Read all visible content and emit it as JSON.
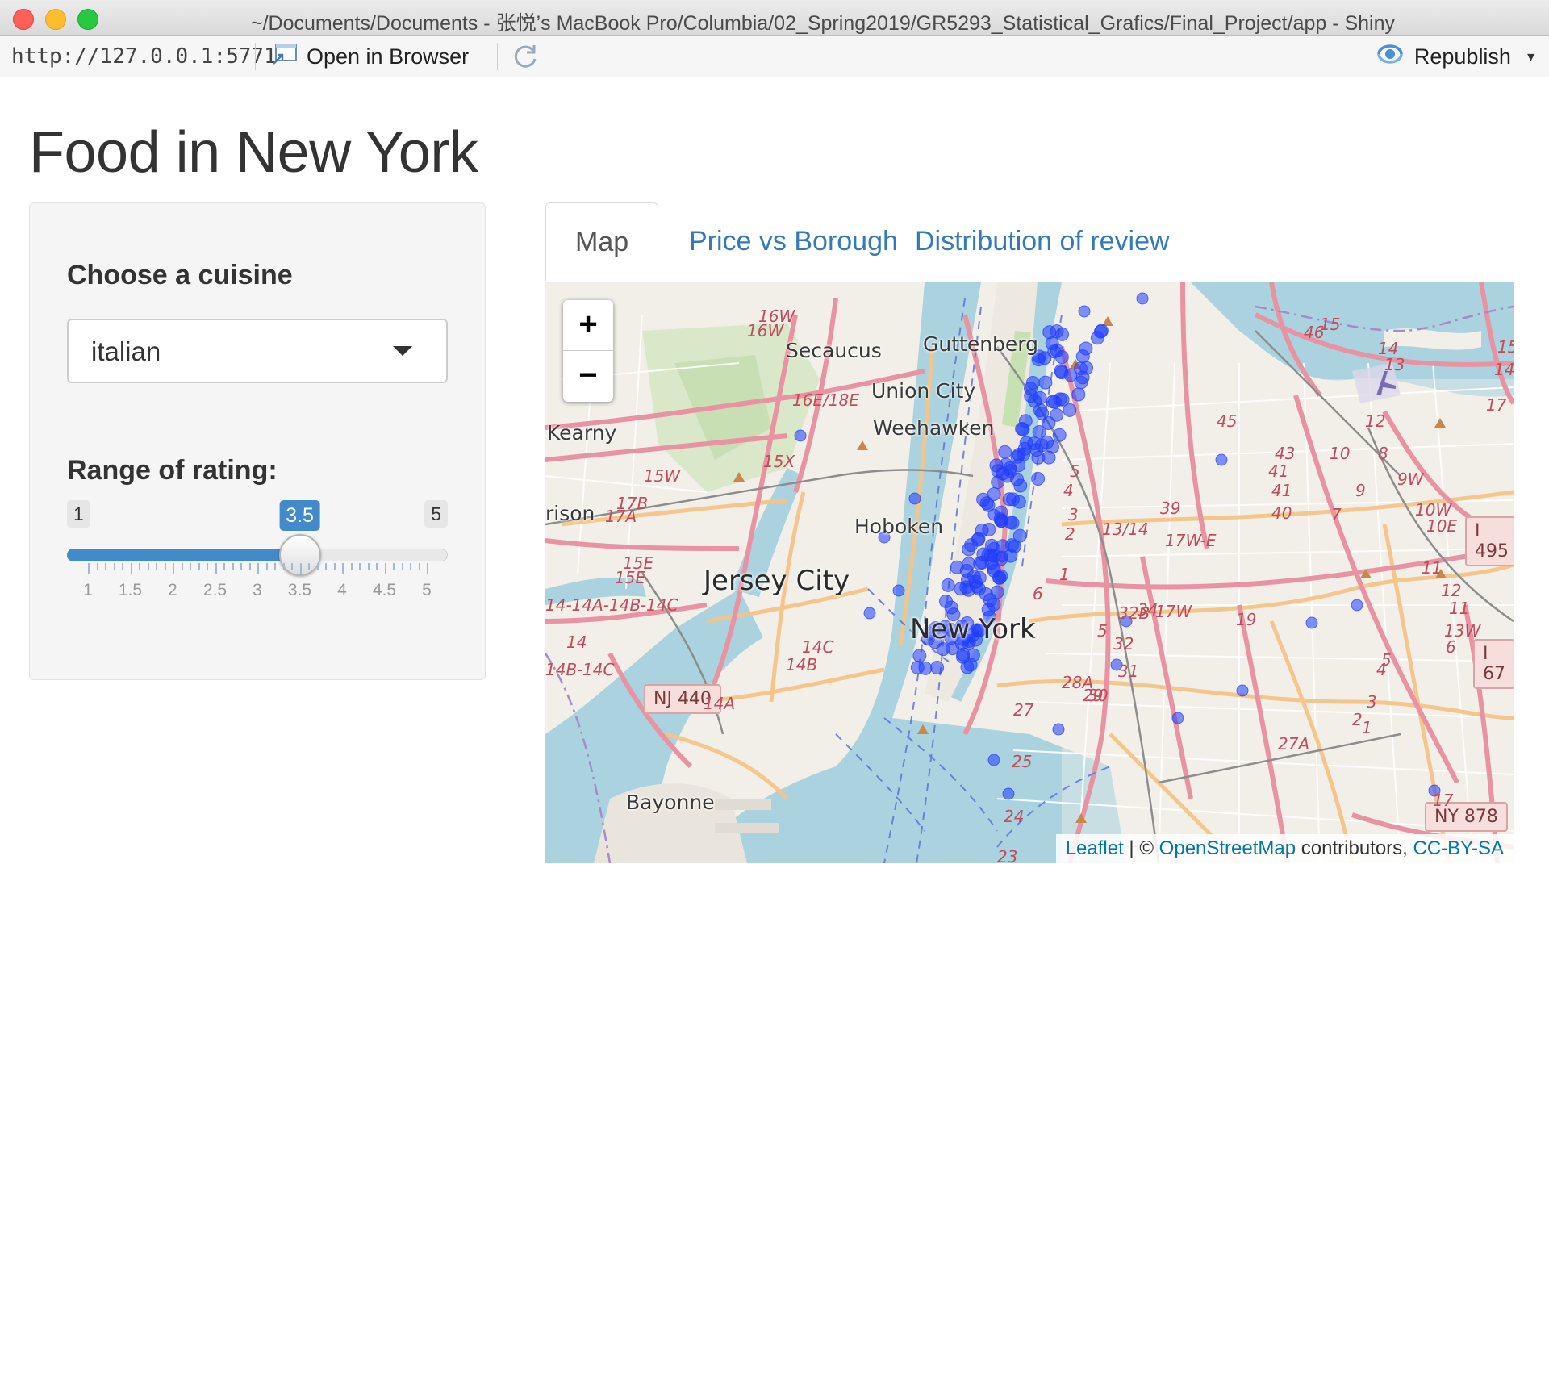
{
  "window": {
    "title": "~/Documents/Documents - 张悦’s MacBook Pro/Columbia/02_Spring2019/GR5293_Statistical_Grafics/Final_Project/app - Shiny"
  },
  "toolbar": {
    "url": "http://127.0.0.1:5771",
    "open_in_browser": "Open in Browser",
    "republish": "Republish",
    "republish_caret": "▾"
  },
  "page": {
    "title": "Food in New York"
  },
  "sidebar": {
    "cuisine_label": "Choose a cuisine",
    "cuisine_value": "italian",
    "rating_label": "Range of rating:",
    "slider": {
      "min": 1,
      "max": 5,
      "value": 3.5,
      "min_label": "1",
      "max_label": "5",
      "value_label": "3.5",
      "tick_labels": [
        "1",
        "1.5",
        "2",
        "2.5",
        "3",
        "3.5",
        "4",
        "4.5",
        "5"
      ]
    }
  },
  "tabs": [
    {
      "label": "Map",
      "active": true
    },
    {
      "label": "Price vs Borough",
      "active": false
    },
    {
      "label": "Distribution of review",
      "active": false
    }
  ],
  "map": {
    "zoom_in": "+",
    "zoom_out": "−",
    "places": {
      "secaucus": "Secaucus",
      "guttenberg": "Guttenberg",
      "union_city": "Union City",
      "weehawken": "Weehawken",
      "kearny": "Kearny",
      "hoboken": "Hoboken",
      "jersey_city": "Jersey City",
      "new_york": "New York",
      "bayonne": "Bayonne",
      "harrison": "rison"
    },
    "shields": {
      "nj440": "NJ 440",
      "ny878": "NY 878",
      "i495": "I 495",
      "i678": "I 67"
    },
    "exit_numbers": [
      "16W",
      "16W",
      "16E/18E",
      "15X",
      "15W",
      "17B",
      "17A",
      "15E",
      "15E",
      "14-14A-14B-14C",
      "14",
      "14B-14C",
      "14C",
      "14B",
      "14A",
      "13/14",
      "17W-E",
      "17W",
      "39",
      "34",
      "19",
      "32B",
      "32",
      "31",
      "29",
      "30",
      "28A",
      "27",
      "25",
      "24",
      "23",
      "43",
      "41",
      "41",
      "40",
      "45",
      "8",
      "9W",
      "10W",
      "10E",
      "11",
      "12",
      "11",
      "13W",
      "6",
      "5",
      "4",
      "3",
      "2",
      "1",
      "27A",
      "17",
      "15",
      "14",
      "17",
      "46",
      "15",
      "14",
      "13",
      "12",
      "10",
      "9",
      "7",
      "5",
      "4",
      "3",
      "2",
      "1",
      "6",
      "5"
    ],
    "attribution": {
      "leaflet": "Leaflet",
      "separator": " | © ",
      "osm": "OpenStreetMap",
      "contributors": " contributors, ",
      "license": "CC-BY-SA"
    },
    "marker_color": "#1f3cff",
    "marker_count": 160
  },
  "colors": {
    "accent": "#428bca",
    "link": "#337ab7",
    "water": "#aad3df",
    "land": "#f2efe9",
    "motorway": "#e892a2",
    "primary_road": "#fcd6a4",
    "marker": "#1f3cff"
  }
}
